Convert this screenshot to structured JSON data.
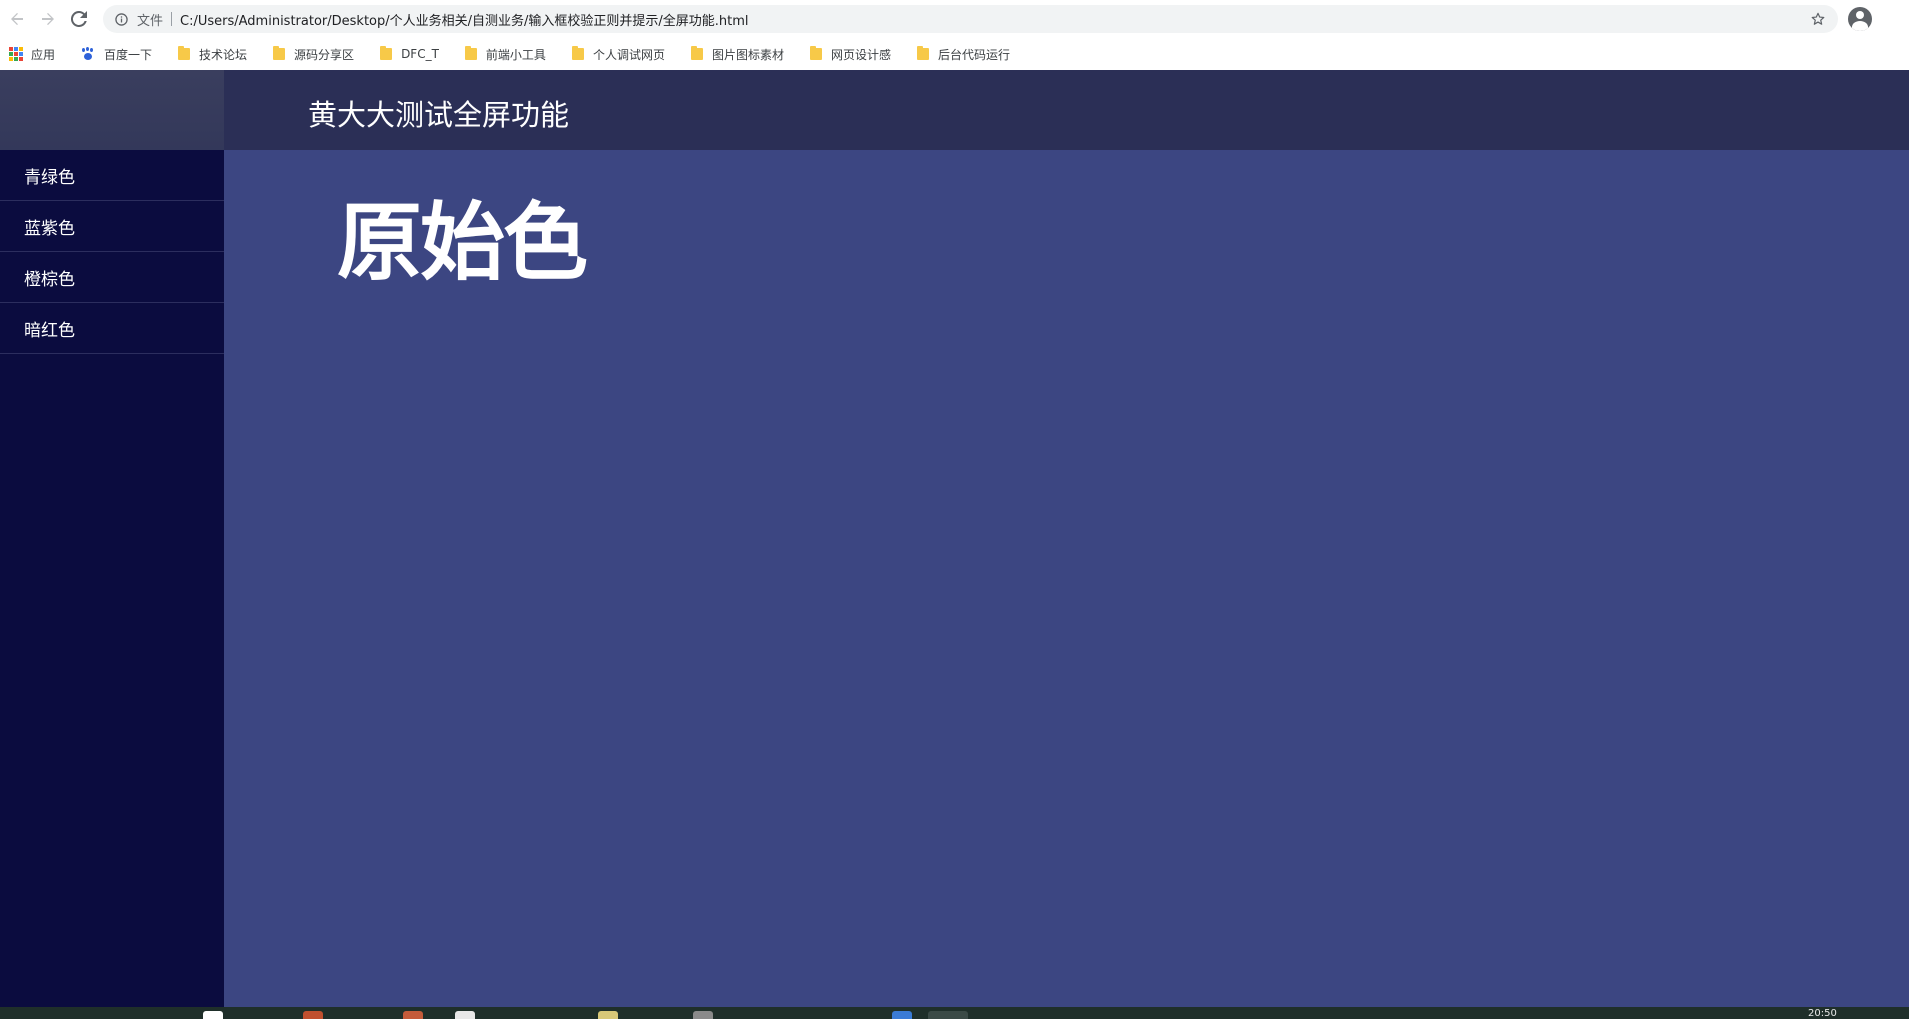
{
  "browser": {
    "scheme_label": "文件",
    "url": "C:/Users/Administrator/Desktop/个人业务相关/自测业务/输入框校验正则并提示/全屏功能.html",
    "bookmarks": [
      {
        "label": "应用",
        "icon": "apps-grid-icon"
      },
      {
        "label": "百度一下",
        "icon": "baidu-paw-icon"
      },
      {
        "label": "技术论坛",
        "icon": "folder-icon"
      },
      {
        "label": "源码分享区",
        "icon": "folder-icon"
      },
      {
        "label": "DFC_T",
        "icon": "folder-icon"
      },
      {
        "label": "前端小工具",
        "icon": "folder-icon"
      },
      {
        "label": "个人调试网页",
        "icon": "folder-icon"
      },
      {
        "label": "图片图标素材",
        "icon": "folder-icon"
      },
      {
        "label": "网页设计感",
        "icon": "folder-icon"
      },
      {
        "label": "后台代码运行",
        "icon": "folder-icon"
      }
    ]
  },
  "header": {
    "title": "黄大大测试全屏功能"
  },
  "sidebar": {
    "items": [
      {
        "label": "青绿色"
      },
      {
        "label": "蓝紫色"
      },
      {
        "label": "橙棕色"
      },
      {
        "label": "暗红色"
      }
    ]
  },
  "main": {
    "headline": "原始色"
  },
  "taskbar": {
    "clock": "20:50"
  },
  "colors": {
    "topbar": "#2b2f56",
    "sidebar": "#0b0c3f",
    "main": "#3c4682",
    "text": "#ffffff"
  }
}
